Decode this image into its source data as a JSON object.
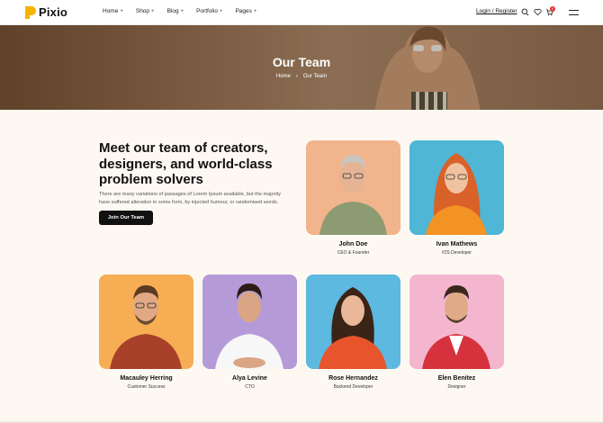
{
  "header": {
    "logo_text": "Pixio",
    "nav": [
      {
        "label": "Home",
        "icon": "+"
      },
      {
        "label": "Shop",
        "icon": "+"
      },
      {
        "label": "Blog",
        "icon": "+"
      },
      {
        "label": "Portfolio",
        "icon": "+"
      },
      {
        "label": "Pages",
        "icon": "+"
      }
    ],
    "login": "Login / Register",
    "cart_count": "0"
  },
  "hero": {
    "title": "Our Team",
    "breadcrumb": [
      "Home",
      "Our Team"
    ],
    "separator": "›"
  },
  "intro": {
    "title": "Meet our team of creators, designers, and world-class problem solvers",
    "text": "There are many variations of passages of Lorem Ipsum available, but the majority have suffered alteration in some form, by injected humour, or randomised words.",
    "button": "Join Our Team"
  },
  "team": [
    {
      "name": "John Doe",
      "role": "CEO & Founder",
      "bg": "#f2b48c"
    },
    {
      "name": "Ivan Mathews",
      "role": "IOS Developer",
      "bg": "#4fb6d6"
    },
    {
      "name": "Macauley Herring",
      "role": "Customer Success",
      "bg": "#f6ad54"
    },
    {
      "name": "Alya Levine",
      "role": "CTO",
      "bg": "#b59ad8"
    },
    {
      "name": "Rose Hernandez",
      "role": "Backend Developer",
      "bg": "#5db9df"
    },
    {
      "name": "Elen Benitez",
      "role": "Designer",
      "bg": "#f4b6cf"
    }
  ],
  "colors": {
    "accent": "#f5b400",
    "dark": "#111111",
    "page_bg": "#fdf9f2"
  }
}
